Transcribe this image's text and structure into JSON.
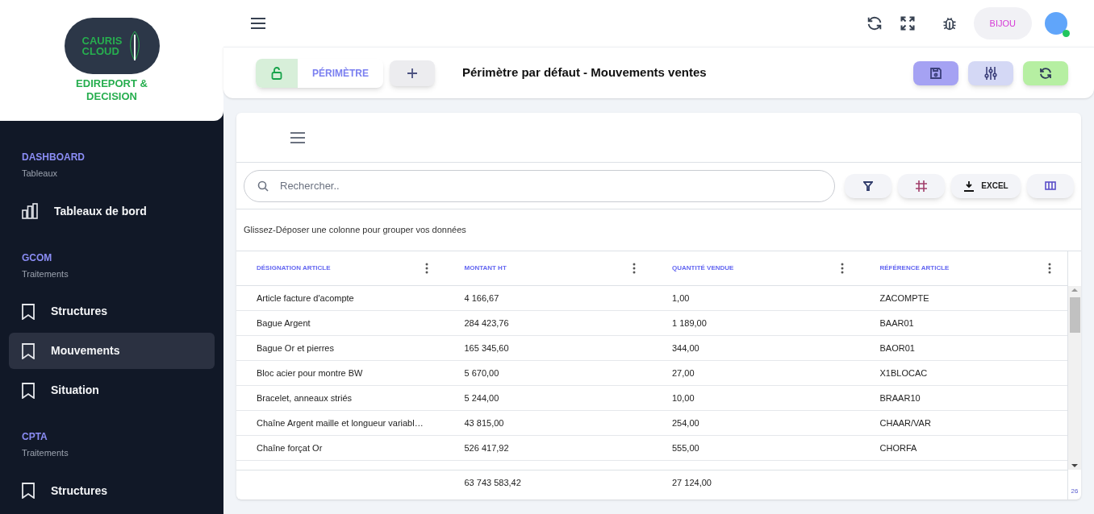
{
  "logo": {
    "line_1": "CAURIS",
    "line_2": "CLOUD",
    "tagline_1": "EDIREPORT &",
    "tagline_2": "DECISION"
  },
  "sidebar": {
    "sections": [
      {
        "title": "DASHBOARD",
        "subtitle": "Tableaux",
        "items": [
          {
            "label": "Tableaux de bord",
            "kind": "chart",
            "selected": false
          }
        ]
      },
      {
        "title": "GCOM",
        "subtitle": "Traitements",
        "items": [
          {
            "label": "Structures",
            "kind": "bookmark",
            "selected": false
          },
          {
            "label": "Mouvements",
            "kind": "bookmark",
            "selected": true
          },
          {
            "label": "Situation",
            "kind": "bookmark",
            "selected": false
          }
        ]
      },
      {
        "title": "CPTA",
        "subtitle": "Traitements",
        "items": [
          {
            "label": "Structures",
            "kind": "bookmark",
            "selected": false
          }
        ]
      }
    ]
  },
  "header": {
    "company": "BIJOU",
    "user_online": true
  },
  "toolbar": {
    "perimeter_button": "PÉRIMÈTRE",
    "title": "Périmètre par défaut - Mouvements ventes"
  },
  "grid": {
    "search_placeholder": "Rechercher..",
    "export_button": "EXCEL",
    "group_hint": "Glissez-Déposer une colonne pour grouper vos données",
    "columns": [
      "DÉSIGNATION ARTICLE",
      "MONTANT HT",
      "QUANTITÉ VENDUE",
      "RÉFÉRENCE ARTICLE"
    ],
    "rows": [
      [
        "Article facture d'acompte",
        "4 166,67",
        "1,00",
        "ZACOMPTE"
      ],
      [
        "Bague Argent",
        "284 423,76",
        "1 189,00",
        "BAAR01"
      ],
      [
        "Bague Or et pierres",
        "165 345,60",
        "344,00",
        "BAOR01"
      ],
      [
        "Bloc acier pour montre BW",
        "5 670,00",
        "27,00",
        "X1BLOCAC"
      ],
      [
        "Bracelet, anneaux striés",
        "5 244,00",
        "10,00",
        "BRAAR10"
      ],
      [
        "Chaîne Argent maille et longueur variabl…",
        "43 815,00",
        "254,00",
        "CHAAR/VAR"
      ],
      [
        "Chaîne forçat Or",
        "526 417,92",
        "555,00",
        "CHORFA"
      ]
    ],
    "totals": {
      "amount": "63 743 583,42",
      "quantity": "27 124,00"
    },
    "row_count": "26"
  }
}
